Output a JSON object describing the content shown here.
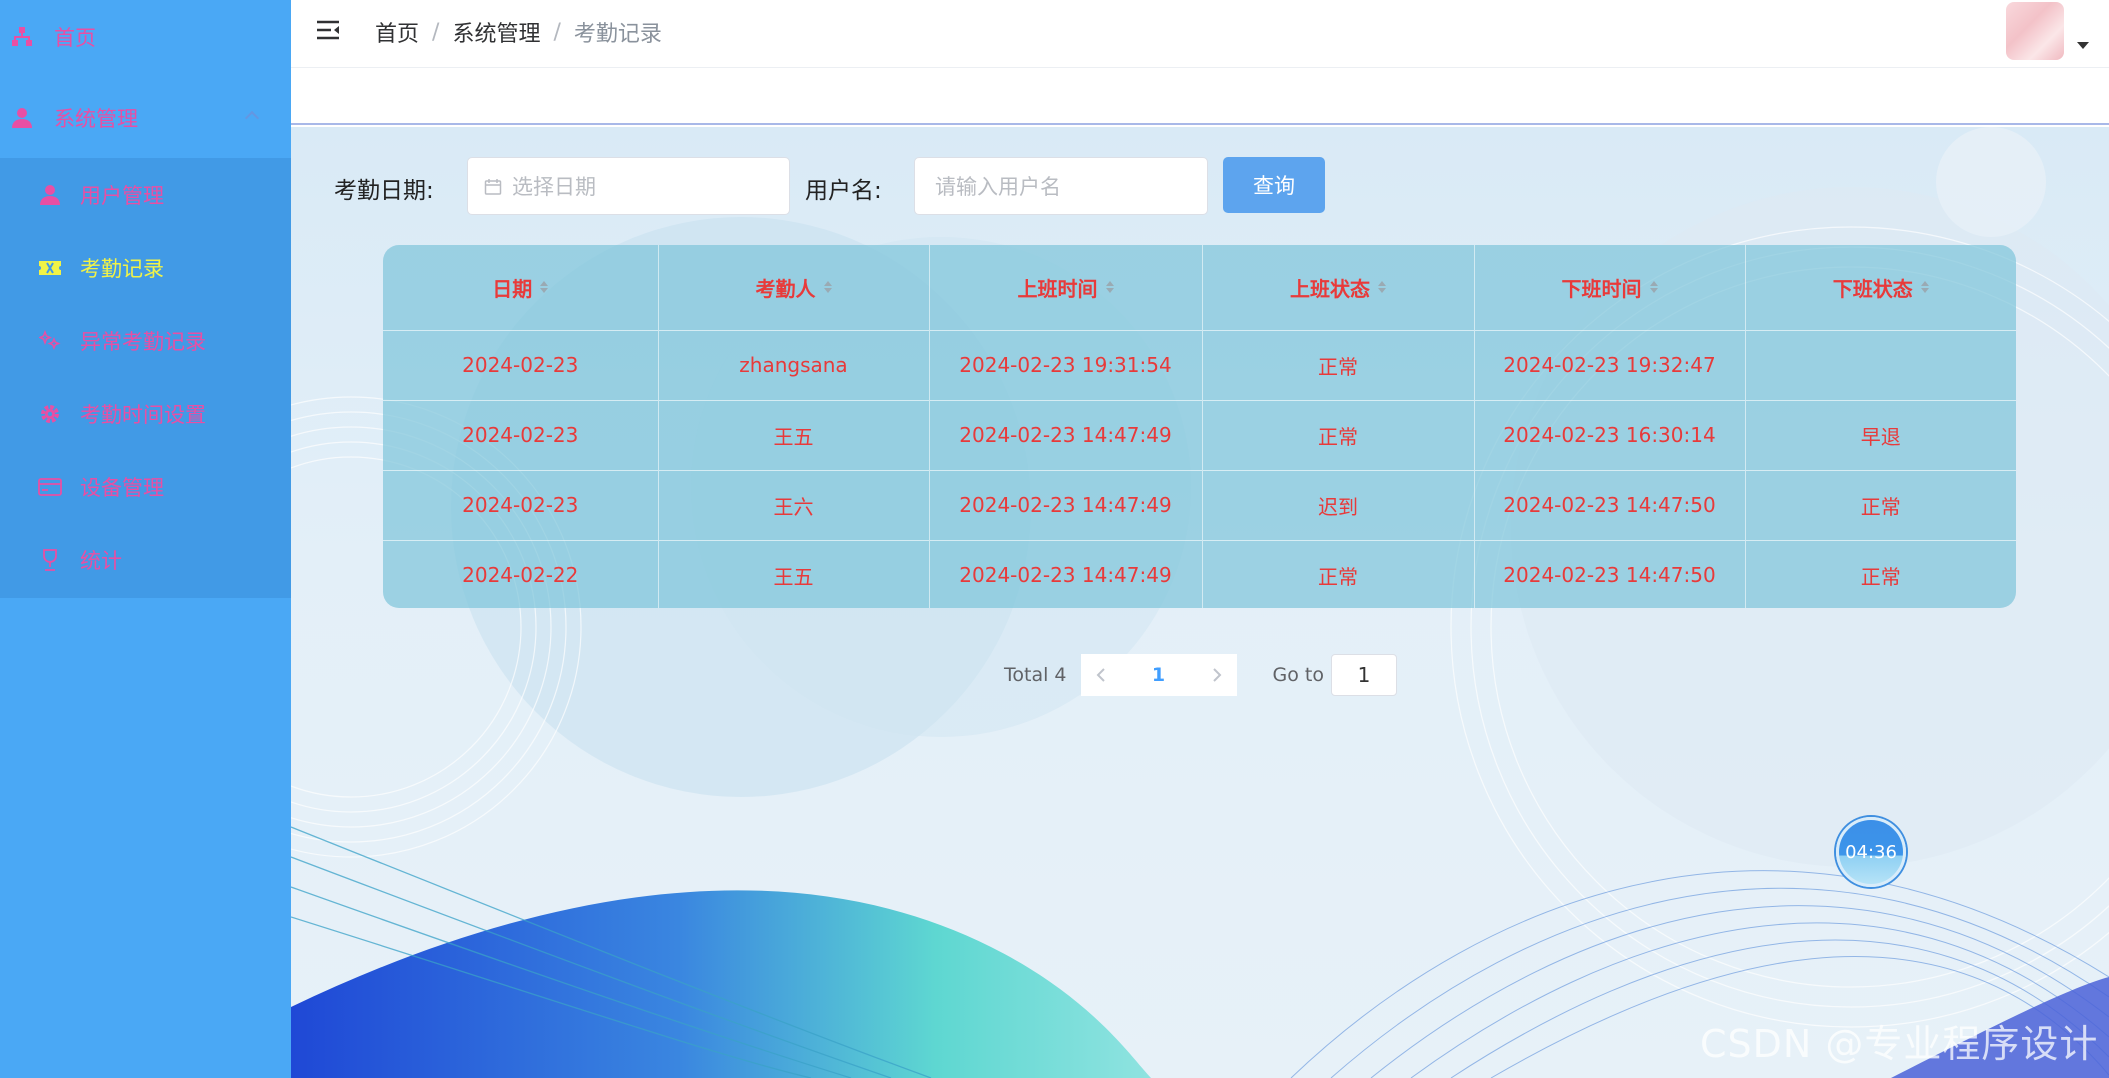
{
  "sidebar": {
    "items": [
      {
        "label": "首页",
        "icon": "sitemap-icon"
      },
      {
        "label": "系统管理",
        "icon": "user-icon"
      }
    ],
    "submenu": [
      {
        "label": "用户管理",
        "icon": "user-icon"
      },
      {
        "label": "考勤记录",
        "icon": "ticket-icon",
        "active": true
      },
      {
        "label": "异常考勤记录",
        "icon": "sparkle-icon"
      },
      {
        "label": "考勤时间设置",
        "icon": "gear-icon"
      },
      {
        "label": "设备管理",
        "icon": "card-icon"
      },
      {
        "label": "统计",
        "icon": "trophy-icon"
      }
    ],
    "colors": {
      "bg": "#4aa8f5",
      "submenu_bg": "#419ae6",
      "text": "#e84fa4",
      "active_text": "#f1f347"
    }
  },
  "header": {
    "breadcrumb": [
      "首页",
      "系统管理",
      "考勤记录"
    ],
    "separator": "/"
  },
  "search": {
    "date_label": "考勤日期:",
    "date_placeholder": "选择日期",
    "user_label": "用户名:",
    "user_placeholder": "请输入用户名",
    "query_button": "查询"
  },
  "table": {
    "columns": [
      "日期",
      "考勤人",
      "上班时间",
      "上班状态",
      "下班时间",
      "下班状态"
    ],
    "rows": [
      [
        "2024-02-23",
        "zhangsana",
        "2024-02-23 19:31:54",
        "正常",
        "2024-02-23 19:32:47",
        ""
      ],
      [
        "2024-02-23",
        "王五",
        "2024-02-23 14:47:49",
        "正常",
        "2024-02-23 16:30:14",
        "早退"
      ],
      [
        "2024-02-23",
        "王六",
        "2024-02-23 14:47:49",
        "迟到",
        "2024-02-23 14:47:50",
        "正常"
      ],
      [
        "2024-02-22",
        "王五",
        "2024-02-23 14:47:49",
        "正常",
        "2024-02-23 14:47:50",
        "正常"
      ]
    ],
    "text_color": "#e83a3a"
  },
  "pagination": {
    "total_text": "Total 4",
    "current_page": "1",
    "goto_label": "Go to",
    "goto_value": "1"
  },
  "timer": {
    "text": "04:36"
  },
  "watermark": "CSDN @专业程序设计"
}
